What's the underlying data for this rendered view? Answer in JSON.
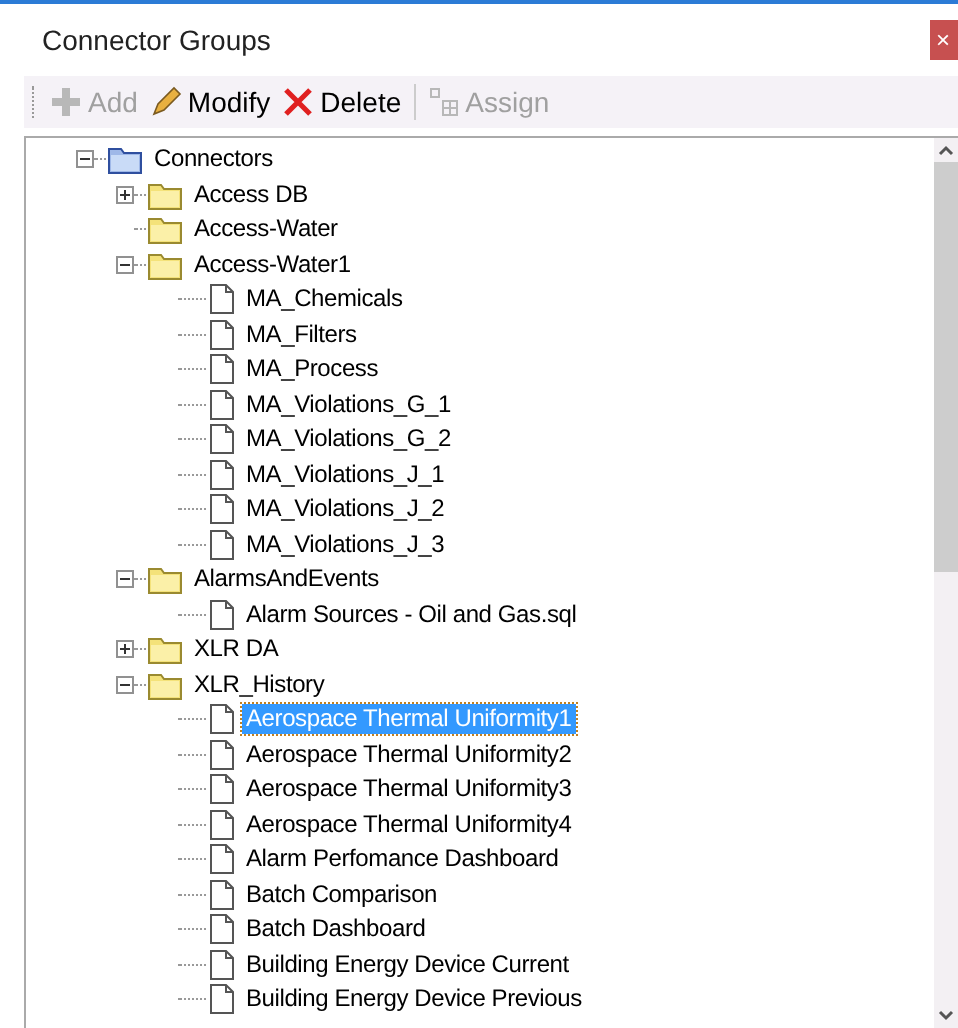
{
  "window": {
    "title": "Connector Groups",
    "close": "×"
  },
  "toolbar": [
    {
      "label": "Add",
      "kind": "add",
      "disabled": true
    },
    {
      "label": "Modify",
      "kind": "modify",
      "disabled": false
    },
    {
      "label": "Delete",
      "kind": "delete",
      "disabled": false
    },
    {
      "label": "Assign",
      "kind": "assign",
      "disabled": true
    }
  ],
  "tree": [
    {
      "label": "Connectors",
      "kind": "root",
      "expanded": true,
      "selected": false,
      "children": [
        {
          "label": "Access DB",
          "kind": "folder",
          "expanded": false,
          "selected": false,
          "has_children": true
        },
        {
          "label": "Access-Water",
          "kind": "folder",
          "selected": false,
          "has_children": false
        },
        {
          "label": "Access-Water1",
          "kind": "folder",
          "expanded": true,
          "selected": false,
          "has_children": true,
          "children": [
            {
              "label": "MA_Chemicals",
              "kind": "file",
              "selected": false
            },
            {
              "label": "MA_Filters",
              "kind": "file",
              "selected": false
            },
            {
              "label": "MA_Process",
              "kind": "file",
              "selected": false
            },
            {
              "label": "MA_Violations_G_1",
              "kind": "file",
              "selected": false
            },
            {
              "label": "MA_Violations_G_2",
              "kind": "file",
              "selected": false
            },
            {
              "label": "MA_Violations_J_1",
              "kind": "file",
              "selected": false
            },
            {
              "label": "MA_Violations_J_2",
              "kind": "file",
              "selected": false
            },
            {
              "label": "MA_Violations_J_3",
              "kind": "file",
              "selected": false
            }
          ]
        },
        {
          "label": "AlarmsAndEvents",
          "kind": "folder",
          "expanded": true,
          "selected": false,
          "has_children": true,
          "children": [
            {
              "label": "Alarm Sources - Oil and Gas.sql",
              "kind": "file",
              "selected": false
            }
          ]
        },
        {
          "label": "XLR DA",
          "kind": "folder",
          "expanded": false,
          "selected": false,
          "has_children": true
        },
        {
          "label": "XLR_History",
          "kind": "folder",
          "expanded": true,
          "selected": false,
          "has_children": true,
          "children": [
            {
              "label": "Aerospace Thermal Uniformity1",
              "kind": "file",
              "selected": true
            },
            {
              "label": "Aerospace Thermal Uniformity2",
              "kind": "file",
              "selected": false
            },
            {
              "label": "Aerospace Thermal Uniformity3",
              "kind": "file",
              "selected": false
            },
            {
              "label": "Aerospace Thermal Uniformity4",
              "kind": "file",
              "selected": false
            },
            {
              "label": "Alarm Perfomance Dashboard",
              "kind": "file",
              "selected": false
            },
            {
              "label": "Batch Comparison",
              "kind": "file",
              "selected": false
            },
            {
              "label": "Batch Dashboard",
              "kind": "file",
              "selected": false
            },
            {
              "label": "Building Energy Device Current",
              "kind": "file",
              "selected": false
            },
            {
              "label": "Building Energy Device Previous",
              "kind": "file",
              "selected": false
            }
          ]
        }
      ]
    }
  ]
}
